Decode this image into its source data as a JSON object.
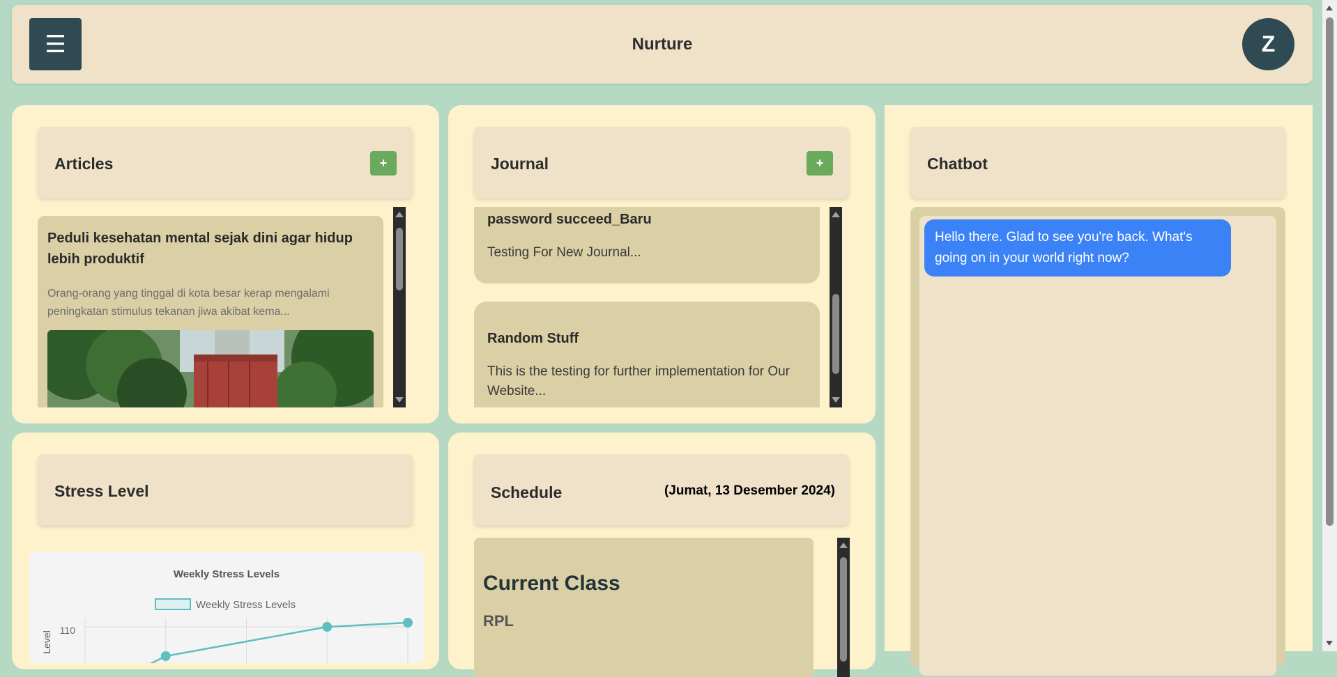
{
  "header": {
    "menu_icon": "☰",
    "title": "Nurture",
    "avatar_initial": "Z"
  },
  "articles": {
    "title": "Articles",
    "add_label": "+",
    "items": [
      {
        "title": "Peduli kesehatan mental sejak dini agar hidup lebih produktif",
        "excerpt": "Orang-orang yang tinggal di kota besar kerap mengalami peningkatan stimulus tekanan jiwa akibat kema...",
        "image": "street-photo-red-container"
      }
    ]
  },
  "journal": {
    "title": "Journal",
    "add_label": "+",
    "items": [
      {
        "title": "password succeed_Baru",
        "text": "Testing For New Journal..."
      },
      {
        "title": "Random Stuff",
        "text": "This is the testing for further implementation for Our Website..."
      }
    ]
  },
  "chatbot": {
    "title": "Chatbot",
    "messages": [
      {
        "from": "bot",
        "text": "Hello there. Glad to see you're back. What's going on in your world right now?"
      }
    ]
  },
  "stress": {
    "title": "Stress Level"
  },
  "schedule": {
    "title": "Schedule",
    "date": "(Jumat, 13 Desember 2024)",
    "current_heading": "Current Class",
    "current_class": "RPL"
  },
  "chart_data": {
    "type": "line",
    "title": "Weekly Stress Levels",
    "ylabel": "Level",
    "series": [
      {
        "name": "Weekly Stress Levels",
        "values": [
          null,
          103,
          null,
          110,
          111
        ],
        "color": "#5fbfbf"
      }
    ],
    "visible_ticks": [
      "110"
    ]
  },
  "colors": {
    "background": "#b5d9c2",
    "panel": "#fdf2cc",
    "header": "#efe2c9",
    "accent_dark": "#2f4a52",
    "add_button": "#6aaa5c",
    "chat_bubble": "#3b82f6"
  }
}
